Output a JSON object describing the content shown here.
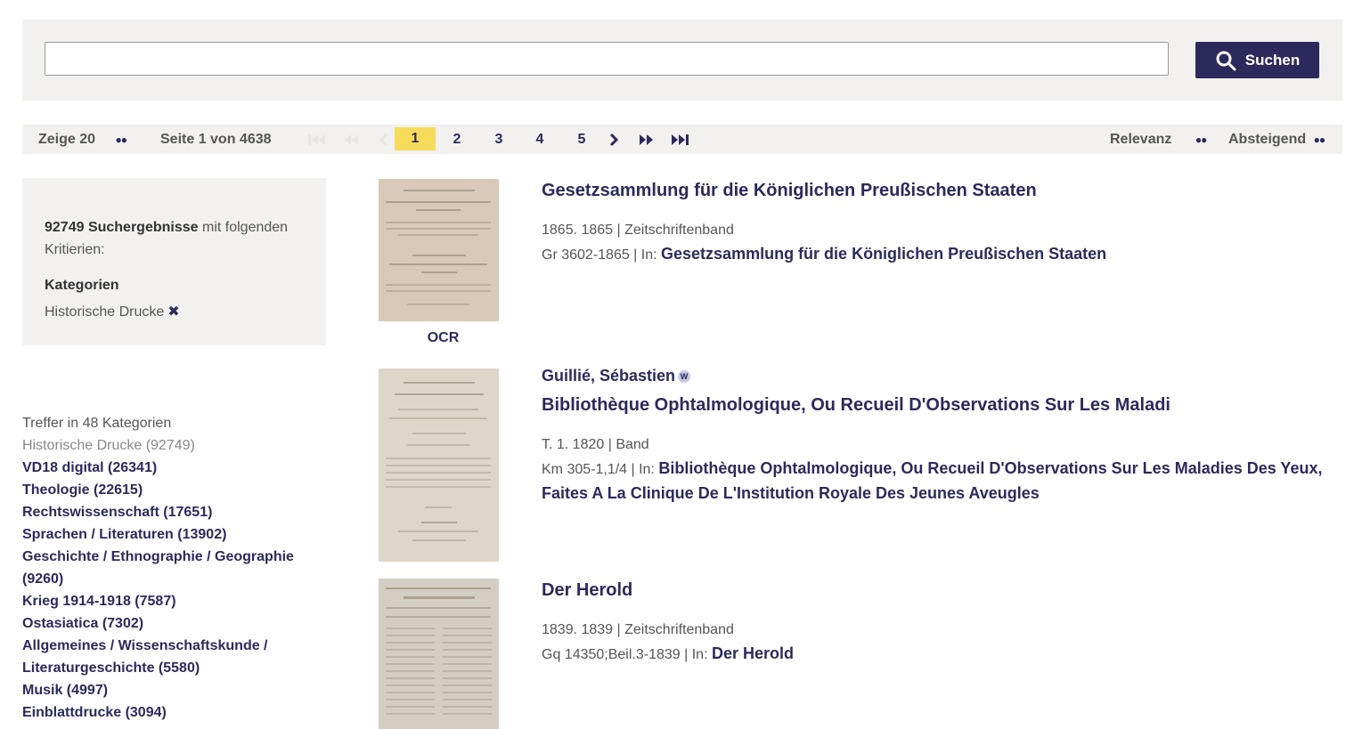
{
  "search": {
    "value": "",
    "placeholder": "",
    "button_label": "Suchen"
  },
  "pager": {
    "per_page_label": "Zeige 20",
    "page_info": "Seite 1 von 4638",
    "pages": [
      "1",
      "2",
      "3",
      "4",
      "5"
    ],
    "current_page": "1",
    "sort_label": "Relevanz",
    "order_label": "Absteigend"
  },
  "filter": {
    "count_bold": "92749 Suchergebnisse",
    "count_rest": " mit folgenden Kritierien:",
    "category_heading": "Kategorien",
    "category_value": "Historische Drucke"
  },
  "categories": {
    "heading": "Treffer in 48 Kategorien",
    "current": "Historische Drucke (92749)",
    "links": [
      "VD18 digital (26341)",
      "Theologie (22615)",
      "Rechtswissenschaft (17651)",
      "Sprachen / Literaturen (13902)",
      "Geschichte / Ethnographie / Geographie (9260)",
      "Krieg 1914-1918 (7587)",
      "Ostasiatica (7302)",
      "Allgemeines / Wissenschaftskunde / Literaturgeschichte (5580)",
      "Musik (4997)",
      "Einblattdrucke (3094)"
    ]
  },
  "results": [
    {
      "title": "Gesetzsammlung für die Königlichen Preußischen Staaten",
      "meta1": "1865. 1865 | Zeitschriftenband",
      "meta2_prefix": "Gr 3602-1865 | In: ",
      "meta2_link": "Gesetzsammlung für die Königlichen Preußischen Staaten",
      "thumb_label": "OCR"
    },
    {
      "author": "Guillié, Sébastien",
      "title": "Bibliothèque Ophtalmologique, Ou Recueil D'Observations Sur Les Maladi",
      "meta1": "T. 1. 1820 | Band",
      "meta2_prefix": "Km 305-1,1/4 | In: ",
      "meta2_link": "Bibliothèque Ophtalmologique, Ou Recueil D'Observations Sur Les Maladies Des Yeux, Faites A La Clinique De L'Institution Royale Des Jeunes Aveugles"
    },
    {
      "title": "Der Herold",
      "meta1": "1839. 1839 | Zeitschriftenband",
      "meta2_prefix": "Gq 14350;Beil.3-1839 | In: ",
      "meta2_link": "Der Herold"
    }
  ]
}
